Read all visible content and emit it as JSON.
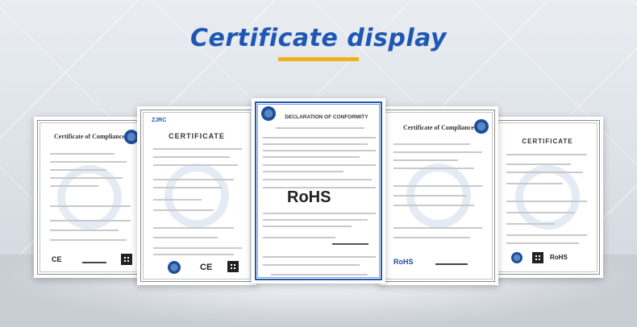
{
  "title": "Certificate display",
  "colors": {
    "title": "#1f57b5",
    "accent_bar": "#f0b21a"
  },
  "certificates": [
    {
      "heading": "Certificate of Compliance",
      "mark": "CE"
    },
    {
      "logo": "ZJRC",
      "heading": "CERTIFICATE",
      "mark": "CE"
    },
    {
      "heading": "DECLARATION OF CONFORMITY",
      "mark": "RoHS"
    },
    {
      "heading": "Certificate of Compliance",
      "mark": "RoHS"
    },
    {
      "heading": "CERTIFICATE",
      "mark": "RoHS"
    }
  ]
}
